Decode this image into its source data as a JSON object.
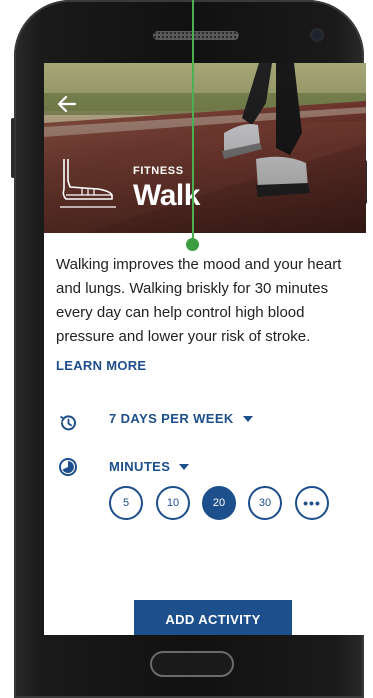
{
  "hero": {
    "category": "FITNESS",
    "title": "Walk"
  },
  "description": "Walking improves the mood and your heart and lungs. Walking briskly for 30 minutes every day can help control high blood pressure and lower your risk of stroke.",
  "learn_more_label": "LEARN MORE",
  "frequency": {
    "selected": "7 DAYS PER WEEK"
  },
  "duration": {
    "unit": "MINUTES",
    "options": [
      "5",
      "10",
      "20",
      "30"
    ],
    "selected": "20",
    "more_label": "•••"
  },
  "add_button_label": "ADD ACTIVITY",
  "colors": {
    "accent": "#1d4f8c",
    "pointer": "#4caf50",
    "text": "#222222"
  }
}
